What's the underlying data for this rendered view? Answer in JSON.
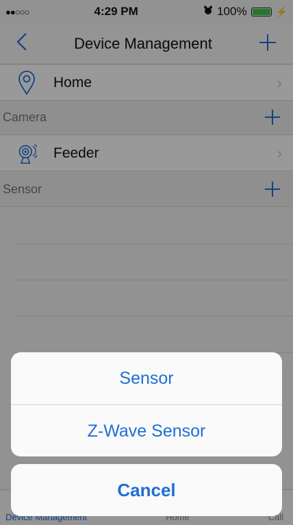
{
  "status": {
    "signal": "●●○○○",
    "time": "4:29 PM",
    "alarm_icon": "alarm-icon",
    "battery": "100%",
    "battery_level": 1.0
  },
  "nav": {
    "title": "Device Management",
    "back_icon": "back-chevron-icon",
    "add_icon": "plus-icon"
  },
  "list": {
    "home": {
      "label": "Home",
      "icon": "location-pin-icon"
    },
    "camera_section": "Camera",
    "feeder": {
      "label": "Feeder",
      "icon": "camera-icon"
    },
    "sensor_section": "Sensor"
  },
  "tabs": [
    "Device Management",
    "Home",
    "Call"
  ],
  "action_sheet": {
    "options": [
      "Sensor",
      "Z-Wave Sensor"
    ],
    "cancel": "Cancel"
  },
  "colors": {
    "accent": "#1f6fd6",
    "battery": "#3dc94d"
  }
}
